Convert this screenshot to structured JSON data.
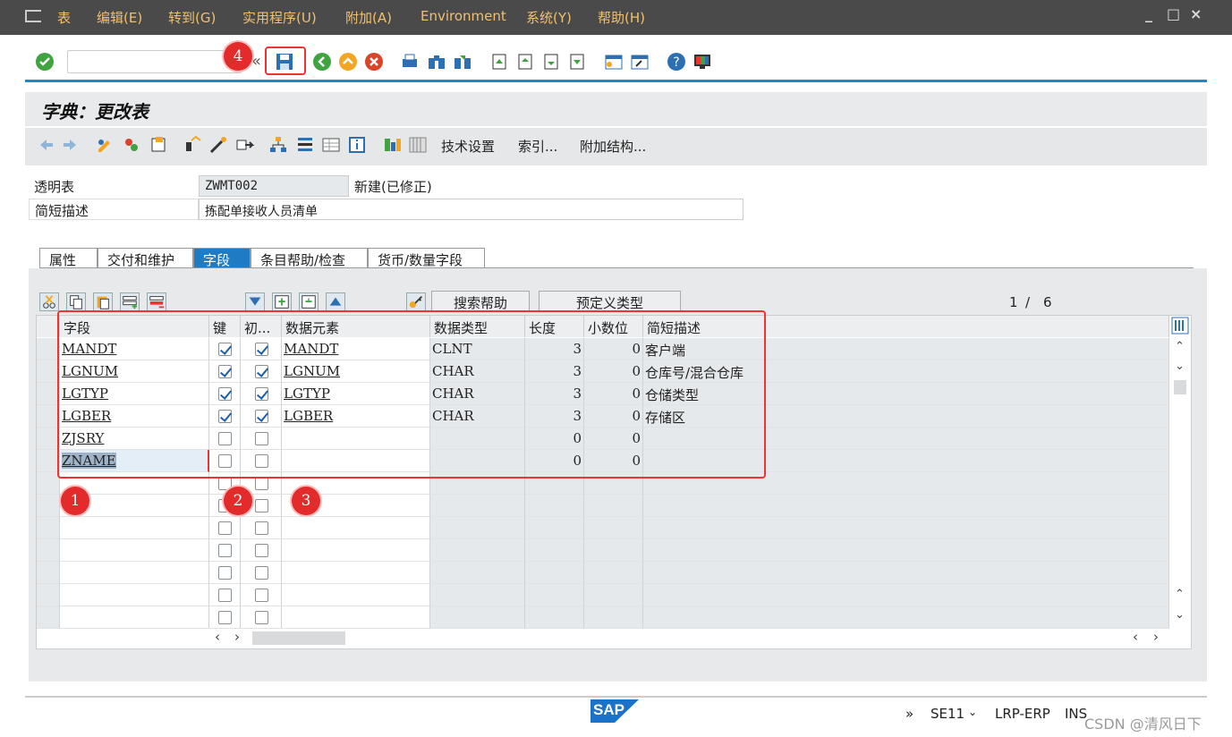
{
  "menu": {
    "items": [
      "表",
      "编辑(E)",
      "转到(G)",
      "实用程序(U)",
      "附加(A)",
      "Environment",
      "系统(Y)",
      "帮助(H)"
    ],
    "window_controls": [
      "_",
      "□",
      "×"
    ]
  },
  "toolbar": {
    "command_value": "",
    "icons": [
      "enter-icon",
      "back-icon",
      "exit-icon",
      "cancel-icon",
      "print-icon",
      "find-icon",
      "find-next-icon",
      "first-page-icon",
      "prev-page-icon",
      "next-page-icon",
      "last-page-icon",
      "new-session-icon",
      "shortcut-icon",
      "help-icon",
      "layout-icon"
    ],
    "expand": "«"
  },
  "title": "字典：更改表",
  "app_toolbar": {
    "buttons": [
      "技术设置",
      "索引...",
      "附加结构..."
    ]
  },
  "header": {
    "table_label": "透明表",
    "table_name": "ZWMT002",
    "table_status": "新建(已修正)",
    "desc_label": "简短描述",
    "desc_value": "拣配单接收人员清单"
  },
  "tabs": [
    "属性",
    "交付和维护",
    "字段",
    "条目帮助/检查",
    "货币/数量字段"
  ],
  "selected_tab": 2,
  "grid_toolbar": {
    "search_help": "搜索帮助",
    "predefined_type": "预定义类型",
    "page_current": "1",
    "page_sep": "/",
    "page_total": "6"
  },
  "columns": [
    "字段",
    "键",
    "初...",
    "数据元素",
    "数据类型",
    "长度",
    "小数位",
    "简短描述"
  ],
  "rows": [
    {
      "field": "MANDT",
      "key": true,
      "init": true,
      "element": "MANDT",
      "type": "CLNT",
      "length": "3",
      "decimals": "0",
      "desc": "客户端"
    },
    {
      "field": "LGNUM",
      "key": true,
      "init": true,
      "element": "LGNUM",
      "type": "CHAR",
      "length": "3",
      "decimals": "0",
      "desc": "仓库号/混合仓库"
    },
    {
      "field": "LGTYP",
      "key": true,
      "init": true,
      "element": "LGTYP",
      "type": "CHAR",
      "length": "3",
      "decimals": "0",
      "desc": "仓储类型"
    },
    {
      "field": "LGBER",
      "key": true,
      "init": true,
      "element": "LGBER",
      "type": "CHAR",
      "length": "3",
      "decimals": "0",
      "desc": "存储区"
    },
    {
      "field": "ZJSRY",
      "key": false,
      "init": false,
      "element": "",
      "type": "",
      "length": "0",
      "decimals": "0",
      "desc": ""
    },
    {
      "field": "ZNAME",
      "key": false,
      "init": false,
      "element": "",
      "type": "",
      "length": "0",
      "decimals": "0",
      "desc": ""
    }
  ],
  "empty_rows": 7,
  "annotations": [
    "1",
    "2",
    "3",
    "4"
  ],
  "status": {
    "more": "»",
    "tcode": "SE11",
    "system": "LRP-ERP",
    "mode": "INS",
    "watermark": "CSDN @清风日下",
    "logo": "SAP"
  },
  "colors": {
    "menu_bg": "#4a4a4a",
    "menu_text": "#f0c070",
    "accent": "#1e88c9",
    "selected_tab": "#1f7cc4",
    "annotation_red": "#e32b2b"
  }
}
